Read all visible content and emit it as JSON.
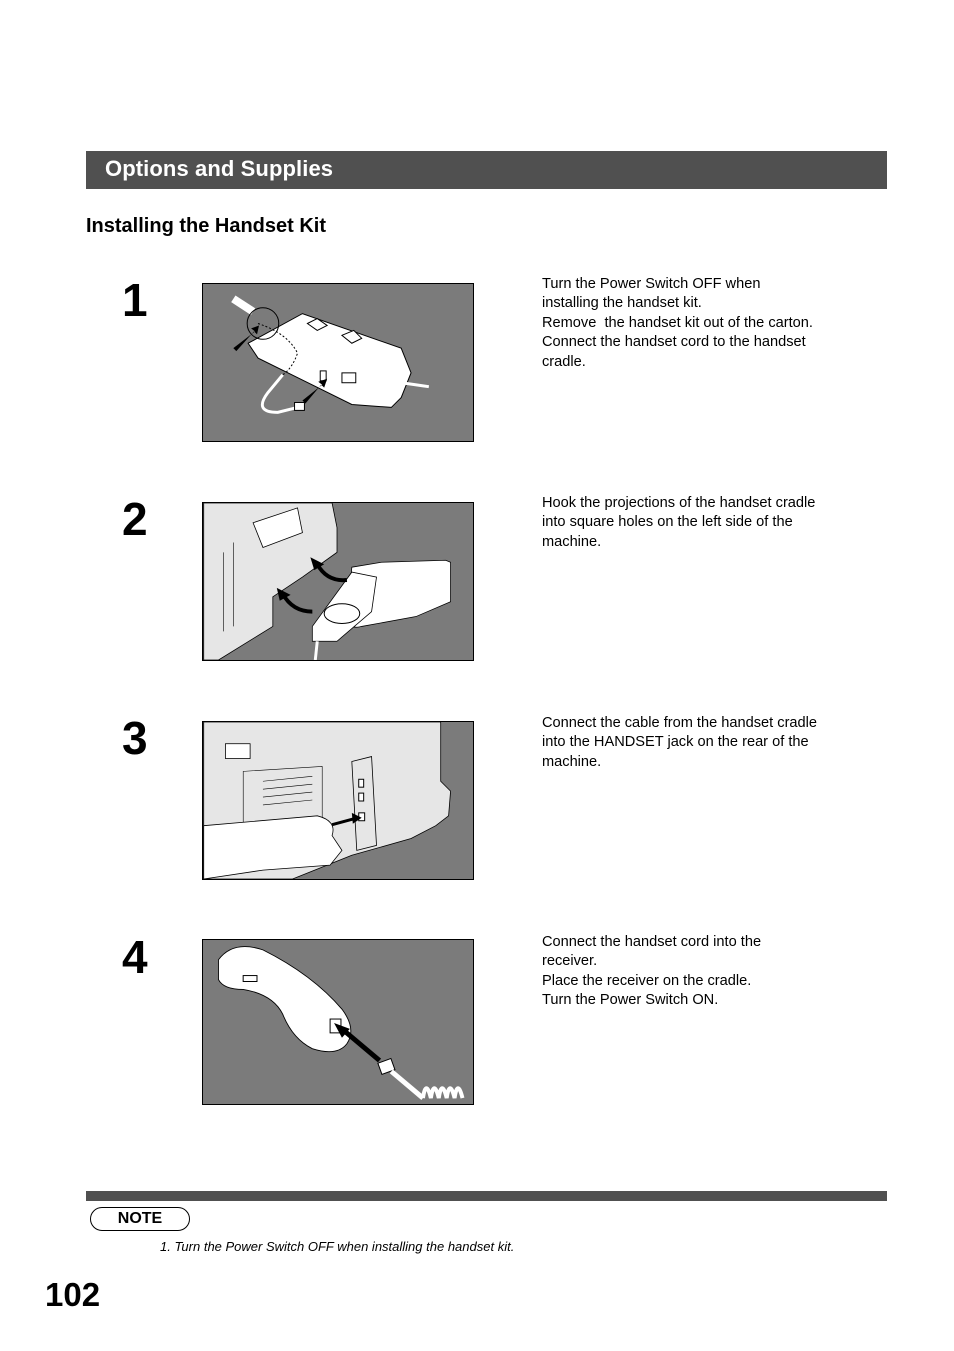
{
  "header": {
    "section_title": "Options and Supplies",
    "subtitle": "Installing the Handset Kit"
  },
  "steps": [
    {
      "number": "1",
      "illustration": "handset-cradle-cord-connection-illustration",
      "lines": [
        "Turn the Power Switch OFF when",
        "installing the handset kit.",
        "Remove  the handset kit out of the carton.",
        "Connect the handset cord to the handset",
        "cradle."
      ]
    },
    {
      "number": "2",
      "illustration": "hook-cradle-onto-machine-illustration",
      "lines": [
        "Hook the projections of the handset cradle",
        "into square holes on the left side of the",
        "machine."
      ]
    },
    {
      "number": "3",
      "illustration": "connect-cable-to-handset-jack-illustration",
      "lines": [
        "Connect the cable from the handset cradle",
        "into the HANDSET jack on the rear of the",
        "machine."
      ]
    },
    {
      "number": "4",
      "illustration": "connect-cord-to-receiver-illustration",
      "lines": [
        "Connect the handset cord into the",
        "receiver.",
        "Place the receiver on the cradle.",
        "Turn the Power Switch ON."
      ]
    }
  ],
  "note": {
    "label": "NOTE",
    "items": [
      "1.  Turn the Power Switch OFF when installing the handset kit."
    ]
  },
  "page_number": "102",
  "colors": {
    "bar": "#505050",
    "illustration_bg": "#7b7b7b",
    "illustration_fg": "#ffffff"
  }
}
